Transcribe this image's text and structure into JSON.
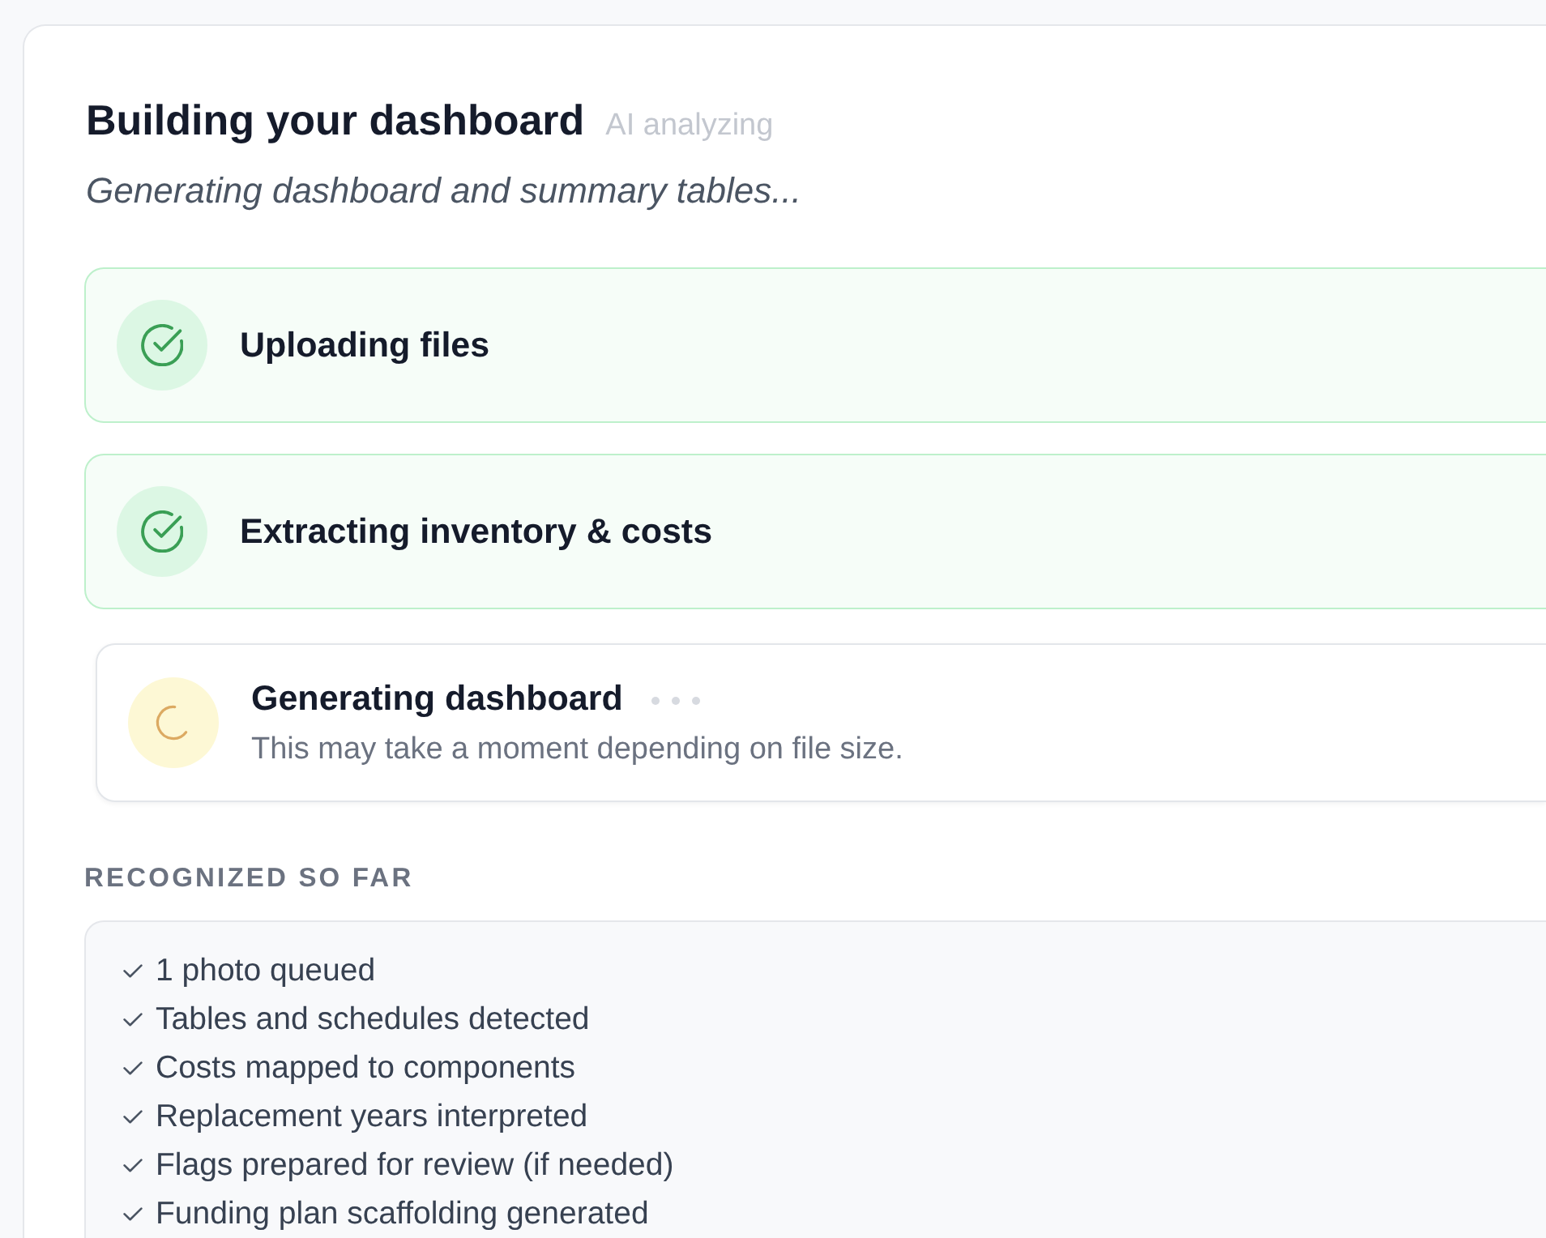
{
  "header": {
    "title": "Building your dashboard",
    "status_label": "AI analyzing",
    "subtitle": "Generating dashboard and summary tables..."
  },
  "steps": [
    {
      "title": "Uploading files",
      "completed": true
    },
    {
      "title": "Extracting inventory & costs",
      "completed": true
    },
    {
      "title": "Generating dashboard",
      "description": "This may take a moment depending on file size.",
      "completed": false
    }
  ],
  "recognized": {
    "heading": "RECOGNIZED SO FAR",
    "items": [
      "1 photo queued",
      "Tables and schedules detected",
      "Costs mapped to components",
      "Replacement years interpreted",
      "Flags prepared for review (if needed)",
      "Funding plan scaffolding generated"
    ]
  }
}
